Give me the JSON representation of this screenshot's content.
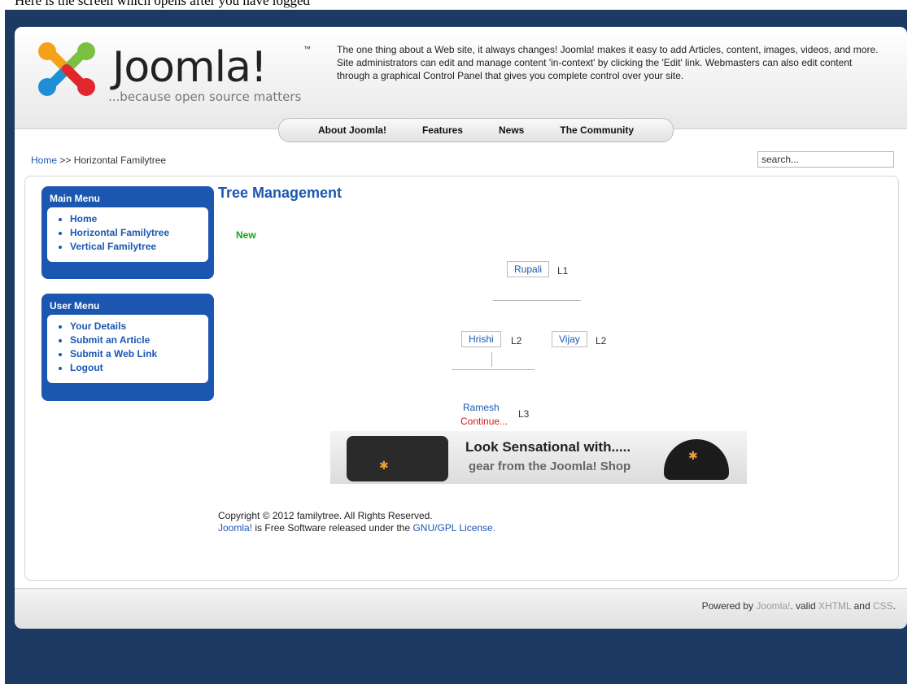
{
  "top_caption": "Here is the screen which opens after you have logged",
  "header": {
    "logo_text": "Joomla!",
    "logo_tm": "™",
    "logo_tagline": "...because open source matters",
    "description": "The one thing about a Web site, it always changes! Joomla! makes it easy to add Articles, content, images, videos, and more. Site administrators can edit and manage content 'in-context' by clicking the 'Edit' link. Webmasters can also edit content through a graphical Control Panel that gives you complete control over your site."
  },
  "nav": {
    "items": [
      {
        "label": "About Joomla!"
      },
      {
        "label": "Features"
      },
      {
        "label": "News"
      },
      {
        "label": "The Community"
      }
    ]
  },
  "breadcrumb": {
    "home": "Home",
    "separator": ">>",
    "current": "Horizontal Familytree"
  },
  "search": {
    "value": "search..."
  },
  "main_menu": {
    "title": "Main Menu",
    "items": [
      {
        "label": "Home"
      },
      {
        "label": "Horizontal Familytree"
      },
      {
        "label": "Vertical Familytree"
      }
    ]
  },
  "user_menu": {
    "title": "User Menu",
    "items": [
      {
        "label": "Your Details"
      },
      {
        "label": "Submit an Article"
      },
      {
        "label": "Submit a Web Link"
      },
      {
        "label": "Logout"
      }
    ]
  },
  "main": {
    "title": "Tree Management",
    "new_label": "New"
  },
  "tree": {
    "rupali": {
      "name": "Rupali",
      "level": "L1"
    },
    "hrishi": {
      "name": "Hrishi",
      "level": "L2"
    },
    "vijay": {
      "name": "Vijay",
      "level": "L2"
    },
    "ramesh": {
      "name": "Ramesh",
      "level": "L3",
      "continue": "Continue..."
    }
  },
  "banner": {
    "line1": "Look Sensational with.....",
    "line2": "gear from the Joomla! Shop"
  },
  "copyright": {
    "line1": "Copyright © 2012 familytree. All Rights Reserved.",
    "joomla_link": "Joomla!",
    "middle": " is Free Software released under the ",
    "license_link": "GNU/GPL License."
  },
  "footer": {
    "powered_by": "Powered by ",
    "joomla_link": "Joomla!",
    "valid": ". valid ",
    "xhtml_link": "XHTML",
    "and": " and ",
    "css_link": "CSS",
    "end": "."
  },
  "colors": {
    "page_bg": "#1c3a62",
    "accent_blue": "#1b57b1",
    "new_green": "#1aa01a",
    "continue_red": "#d41a1a"
  }
}
